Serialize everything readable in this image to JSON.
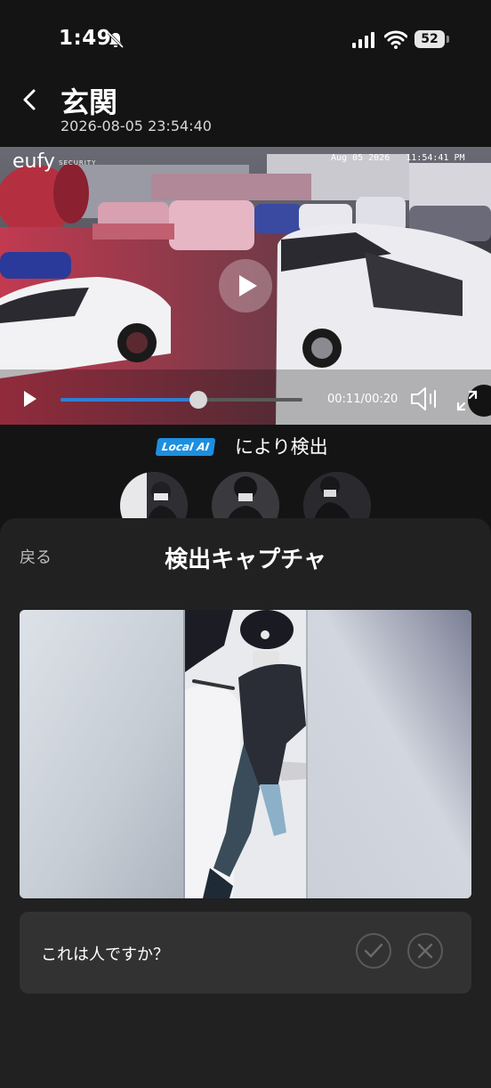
{
  "status_bar": {
    "time": "1:49",
    "battery": "52"
  },
  "header": {
    "title": "玄関",
    "datetime": "2026-08-05 23:54:40"
  },
  "video": {
    "brand": "eufy",
    "brand_sub": "SECURITY",
    "osd": "Aug 05 2026   11:54:41 PM",
    "current_time": "00:11",
    "duration": "00:20",
    "time_display": "00:11/00:20",
    "progress": 0.57
  },
  "detection": {
    "badge": "Local AI",
    "label": "により検出"
  },
  "sheet": {
    "back_label": "戻る",
    "title": "検出キャプチャ",
    "question": "これは人ですか？"
  },
  "colors": {
    "accent": "#2f7fd6",
    "badge": "#1d8fe0",
    "background": "#141414",
    "sheet": "#212121"
  }
}
